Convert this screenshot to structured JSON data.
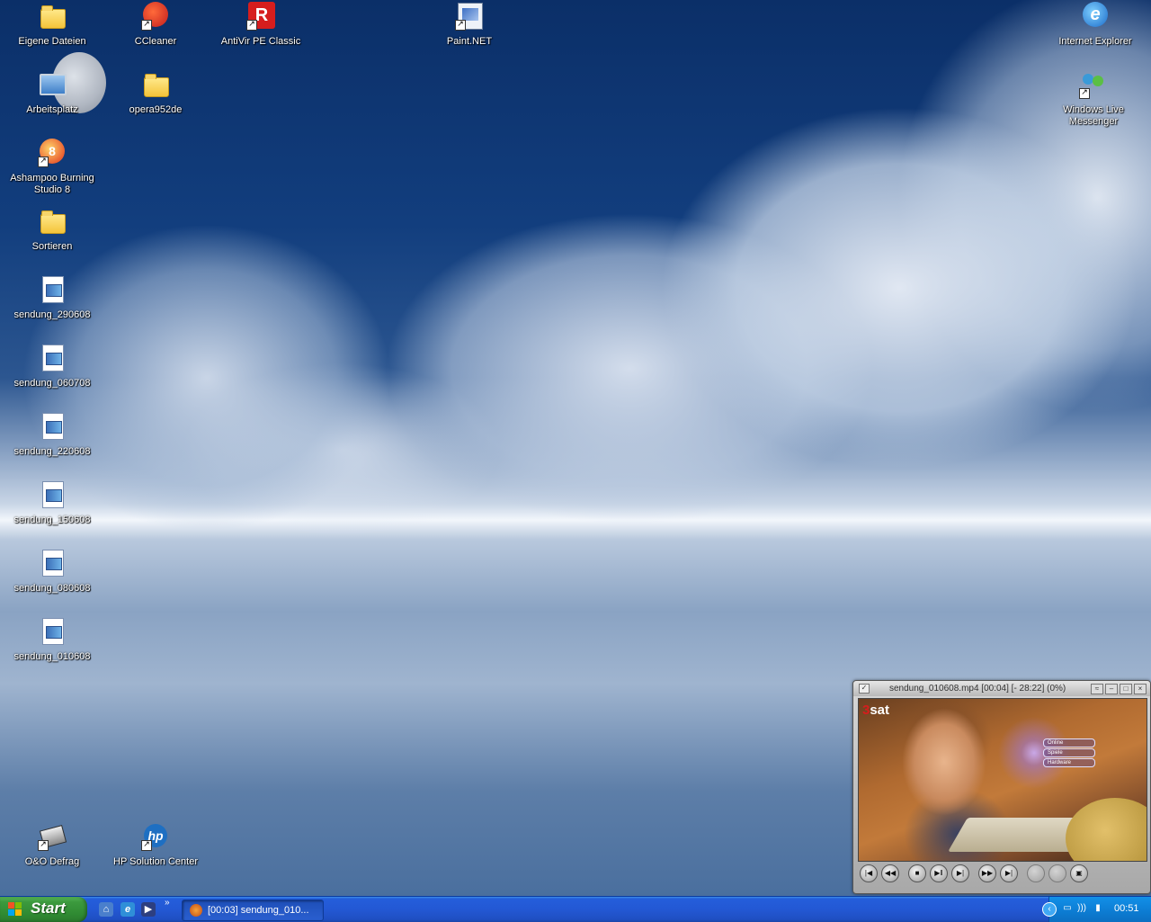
{
  "desktop": {
    "icons": [
      {
        "id": "eigene-dateien",
        "label": "Eigene Dateien",
        "icon": "my-documents-icon"
      },
      {
        "id": "ccleaner",
        "label": "CCleaner",
        "icon": "ccleaner-icon"
      },
      {
        "id": "antivir",
        "label": "AntiVir PE Classic",
        "icon": "antivir-icon"
      },
      {
        "id": "paintnet",
        "label": "Paint.NET",
        "icon": "paintnet-icon"
      },
      {
        "id": "ie",
        "label": "Internet Explorer",
        "icon": "internet-explorer-icon"
      },
      {
        "id": "arbeitsplatz",
        "label": "Arbeitsplatz",
        "icon": "my-computer-icon"
      },
      {
        "id": "opera",
        "label": "opera952de",
        "icon": "folder-icon"
      },
      {
        "id": "messenger",
        "label_line1": "Windows Live",
        "label_line2": "Messenger",
        "icon": "messenger-icon"
      },
      {
        "id": "ashampoo",
        "label_line1": "Ashampoo Burning",
        "label_line2": "Studio 8",
        "icon": "ashampoo-icon"
      },
      {
        "id": "sortieren",
        "label": "Sortieren",
        "icon": "folder-icon"
      },
      {
        "id": "s290608",
        "label": "sendung_290608",
        "icon": "video-file-icon"
      },
      {
        "id": "s060708",
        "label": "sendung_060708",
        "icon": "video-file-icon"
      },
      {
        "id": "s220608",
        "label": "sendung_220608",
        "icon": "video-file-icon"
      },
      {
        "id": "s150608",
        "label": "sendung_150608",
        "icon": "video-file-icon"
      },
      {
        "id": "s080608",
        "label": "sendung_080608",
        "icon": "video-file-icon"
      },
      {
        "id": "s010608",
        "label": "sendung_010608",
        "icon": "video-file-icon"
      },
      {
        "id": "oo",
        "label": "O&O Defrag",
        "icon": "defrag-icon"
      },
      {
        "id": "hp",
        "label": "HP Solution Center",
        "icon": "hp-icon"
      }
    ]
  },
  "player": {
    "title": "sendung_010608.mp4 [00:04] [- 28:22] (0%)",
    "channel_logo_num": "3",
    "channel_logo_text": "sat",
    "on_screen_menu": [
      "Online",
      "Spiele",
      "Hardware"
    ],
    "controls": [
      "skip-back-icon",
      "rewind-icon",
      "stop-icon",
      "play-pause-icon",
      "frame-step-icon",
      "fast-forward-icon",
      "skip-forward-icon"
    ]
  },
  "taskbar": {
    "start_label": "Start",
    "task_label": "[00:03] sendung_010...",
    "clock": "00:51",
    "colors": {
      "taskbar": "#245edb",
      "start": "#3c9a3e",
      "tray": "#0d7fd6"
    }
  }
}
